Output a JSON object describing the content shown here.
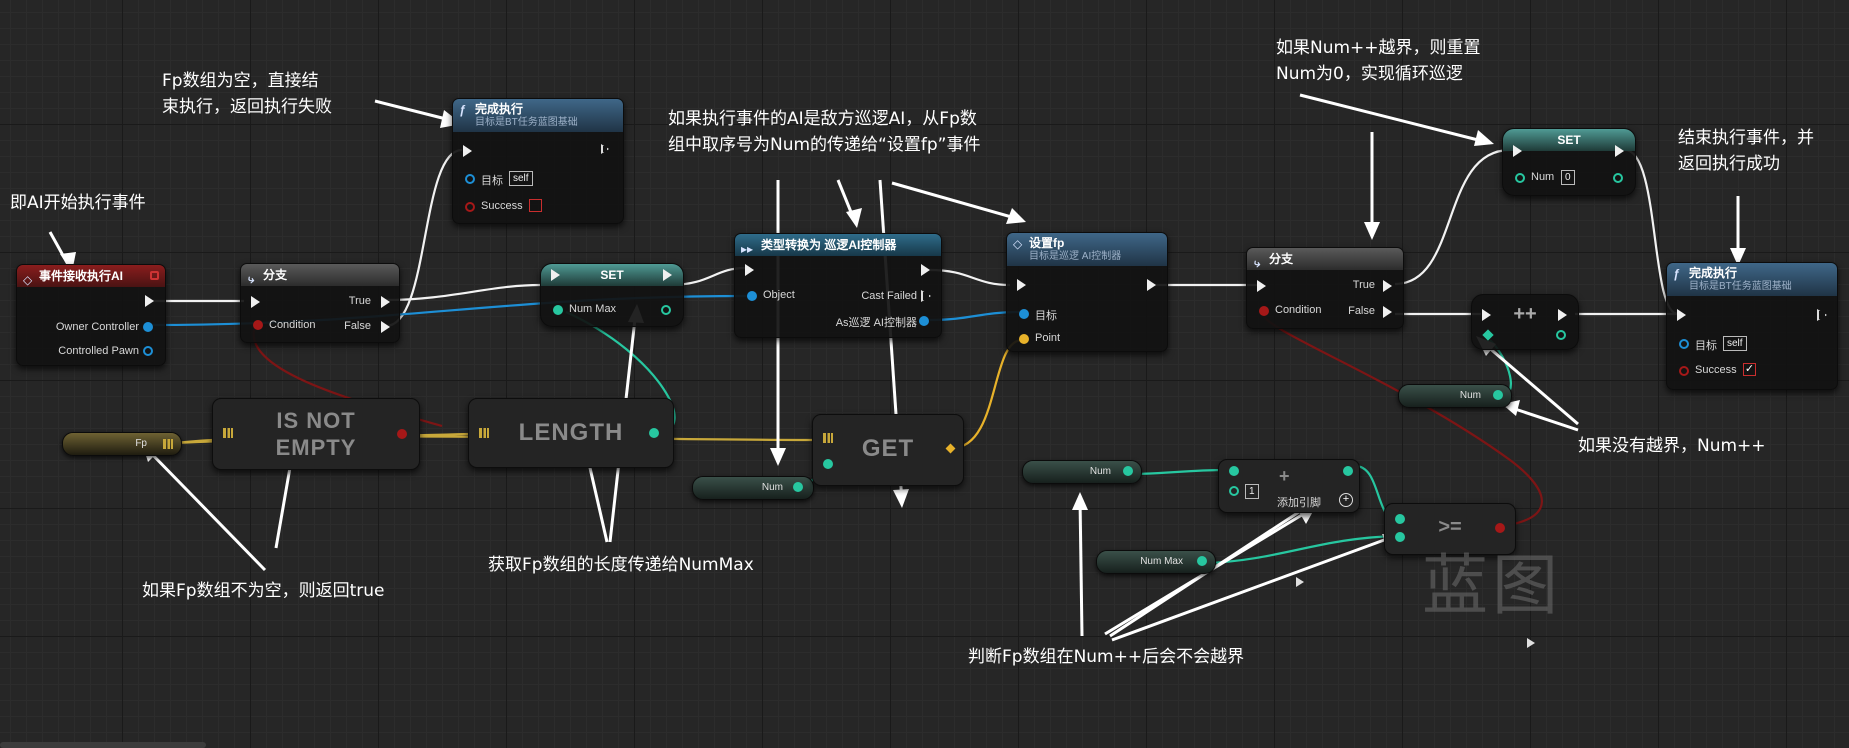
{
  "nodes": {
    "event": {
      "title": "事件接收执行AI",
      "owner": "Owner Controller",
      "pawn": "Controlled Pawn"
    },
    "branch1": {
      "title": "分支",
      "cond": "Condition",
      "t": "True",
      "f": "False"
    },
    "finish_fail": {
      "title": "完成执行",
      "sub": "目标是BT任务蓝图基础",
      "target": "目标",
      "self": "self",
      "success": "Success"
    },
    "set_max": {
      "title": "SET",
      "var": "Num Max"
    },
    "cast": {
      "title": "类型转换为 巡逻AI控制器",
      "obj": "Object",
      "failed": "Cast Failed",
      "as": "As巡逻 AI控制器"
    },
    "setfp": {
      "title": "设置fp",
      "sub": "目标是巡逻 AI控制器",
      "target": "目标",
      "point": "Point"
    },
    "branch2": {
      "title": "分支",
      "cond": "Condition",
      "t": "True",
      "f": "False"
    },
    "set_num": {
      "title": "SET",
      "var": "Num",
      "val": "0"
    },
    "inc": {
      "title": "++"
    },
    "finish_ok": {
      "title": "完成执行",
      "sub": "目标是BT任务蓝图基础",
      "target": "目标",
      "self": "self",
      "success": "Success"
    },
    "fp_var": {
      "label": "Fp"
    },
    "isnotempty": {
      "title": "IS NOT EMPTY"
    },
    "length": {
      "title": "LENGTH"
    },
    "num_get": {
      "label": "Num"
    },
    "get": {
      "title": "GET"
    },
    "num_add_in": {
      "label": "Num"
    },
    "add": {
      "val": "1",
      "add_pin": "添加引脚"
    },
    "numax_get": {
      "label": "Num Max"
    },
    "gte": {
      "title": ">="
    },
    "num_inc": {
      "label": "Num"
    }
  },
  "annotations": {
    "a1": "Fp数组为空，直接结\n束执行，返回执行失败",
    "a2": "即AI开始执行事件",
    "a3": "如果执行事件的AI是敌方巡逻AI，从Fp数\n组中取序号为Num的传递给“设置fp”事件",
    "a4": "如果Num++越界，则重置\nNum为0，实现循环巡逻",
    "a5": "结束执行事件，并\n返回执行成功",
    "a6": "如果没有越界，Num++",
    "a7": "获取Fp数组的长度传递给NumMax",
    "a8": "如果Fp数组不为空，则返回true",
    "a9": "判断Fp数组在Num++后会不会越界"
  },
  "watermark": "蓝图",
  "colors": {
    "exec": "#f0f0f0",
    "object": "#1d8fd6",
    "bool": "#a61818",
    "int": "#27c7a0",
    "struct": "#e8b22a",
    "array": "#c8a83a"
  }
}
